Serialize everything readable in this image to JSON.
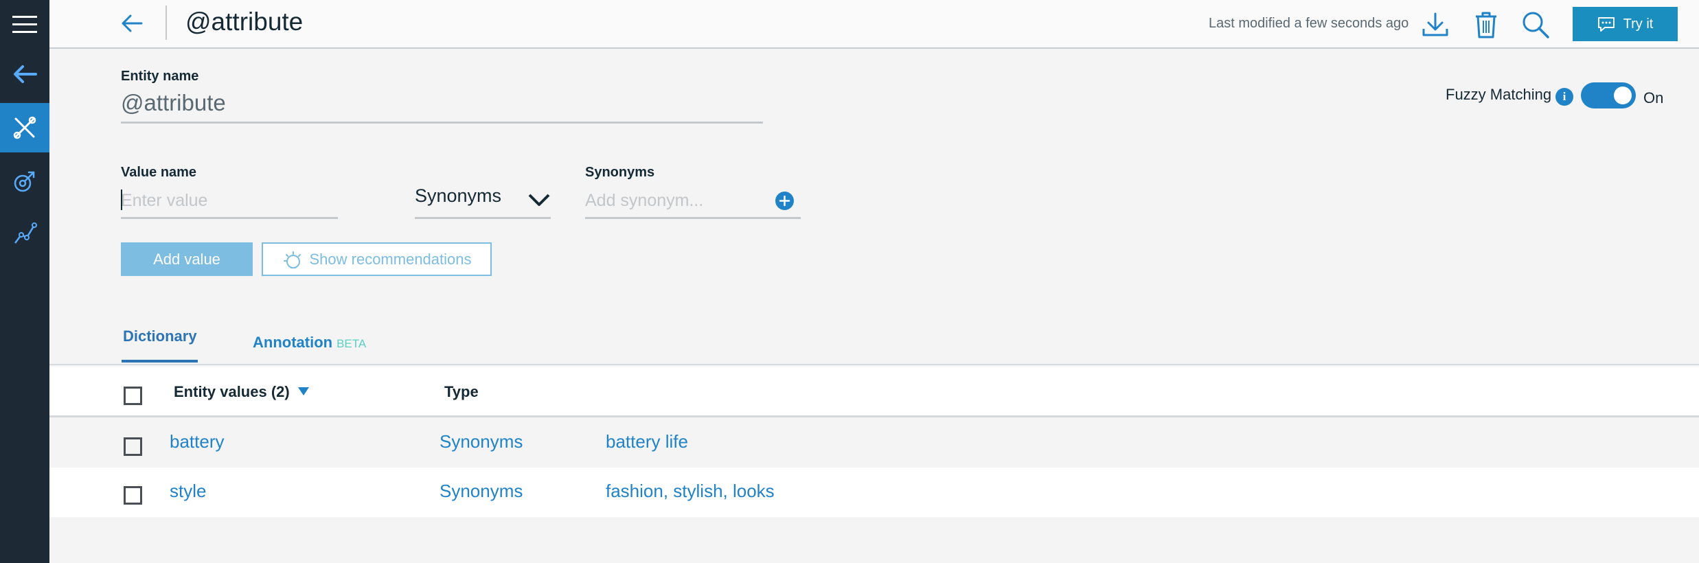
{
  "header": {
    "title": "@attribute",
    "last_modified": "Last modified a few seconds ago",
    "try_it_label": "Try it"
  },
  "entity": {
    "name_label": "Entity name",
    "name_value": "@attribute"
  },
  "fuzzy_matching": {
    "label": "Fuzzy Matching",
    "info_glyph": "i",
    "state": "On",
    "enabled": true
  },
  "value_form": {
    "value_name_label": "Value name",
    "value_placeholder": "Enter value",
    "type_selected": "Synonyms",
    "synonyms_label": "Synonyms",
    "synonym_placeholder": "Add synonym...",
    "add_value_label": "Add value",
    "show_recs_label": "Show recommendations"
  },
  "tabs": {
    "dictionary": "Dictionary",
    "annotation": "Annotation",
    "annotation_badge": "BETA"
  },
  "table": {
    "col_values": "Entity values (2)",
    "col_type": "Type",
    "rows": [
      {
        "value": "battery",
        "type": "Synonyms",
        "synonyms": "battery life"
      },
      {
        "value": "style",
        "type": "Synonyms",
        "synonyms": "fashion, stylish, looks"
      }
    ]
  },
  "icons": {
    "rail": [
      "menu-icon",
      "back-icon",
      "tools-icon",
      "intents-icon",
      "analytics-icon"
    ],
    "header": [
      "back-arrow-icon",
      "download-icon",
      "trash-icon",
      "search-icon",
      "chat-icon"
    ]
  },
  "colors": {
    "rail": "#1d2a36",
    "accent": "#2083c7",
    "try_button": "#1a8fbf",
    "disabled_button": "#7cbde1",
    "beta": "#5bd0c4"
  }
}
